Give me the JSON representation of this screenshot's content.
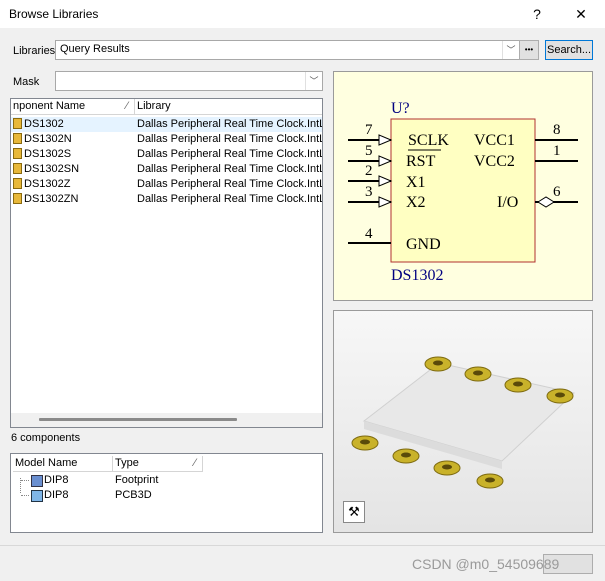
{
  "window": {
    "title": "Browse Libraries",
    "help": "?",
    "close": "✕"
  },
  "libraries": {
    "label": "Libraries",
    "value": "Query Results",
    "more": "•••",
    "search_button": "Search..."
  },
  "mask": {
    "label": "Mask",
    "value": ""
  },
  "components": {
    "columns": [
      "nponent Name",
      "Library"
    ],
    "rows": [
      {
        "name": "DS1302",
        "library": "Dallas Peripheral Real Time Clock.IntLib"
      },
      {
        "name": "DS1302N",
        "library": "Dallas Peripheral Real Time Clock.IntLib"
      },
      {
        "name": "DS1302S",
        "library": "Dallas Peripheral Real Time Clock.IntLib"
      },
      {
        "name": "DS1302SN",
        "library": "Dallas Peripheral Real Time Clock.IntLib"
      },
      {
        "name": "DS1302Z",
        "library": "Dallas Peripheral Real Time Clock.IntLib"
      },
      {
        "name": "DS1302ZN",
        "library": "Dallas Peripheral Real Time Clock.IntLib"
      }
    ],
    "count_text": "6 components"
  },
  "models": {
    "columns": [
      "Model Name",
      "Type"
    ],
    "rows": [
      {
        "name": "DIP8",
        "type": "Footprint"
      },
      {
        "name": "DIP8",
        "type": "PCB3D"
      }
    ]
  },
  "schematic": {
    "designator": "U?",
    "part": "DS1302",
    "left_pins": [
      {
        "num": "7",
        "name": "SCLK"
      },
      {
        "num": "5",
        "name": "RST"
      },
      {
        "num": "2",
        "name": "X1"
      },
      {
        "num": "3",
        "name": "X2"
      },
      {
        "num": "4",
        "name": "GND"
      }
    ],
    "right_pins": [
      {
        "num": "8",
        "name": "VCC1"
      },
      {
        "num": "1",
        "name": "VCC2"
      },
      {
        "num": "6",
        "name": "I/O"
      }
    ],
    "colors": {
      "body_fill": "#ffffc2",
      "body_stroke": "#b03030",
      "text": "#000080",
      "background": "#ffffe0"
    }
  },
  "footer": {
    "watermark": "CSDN @m0_54509689"
  }
}
